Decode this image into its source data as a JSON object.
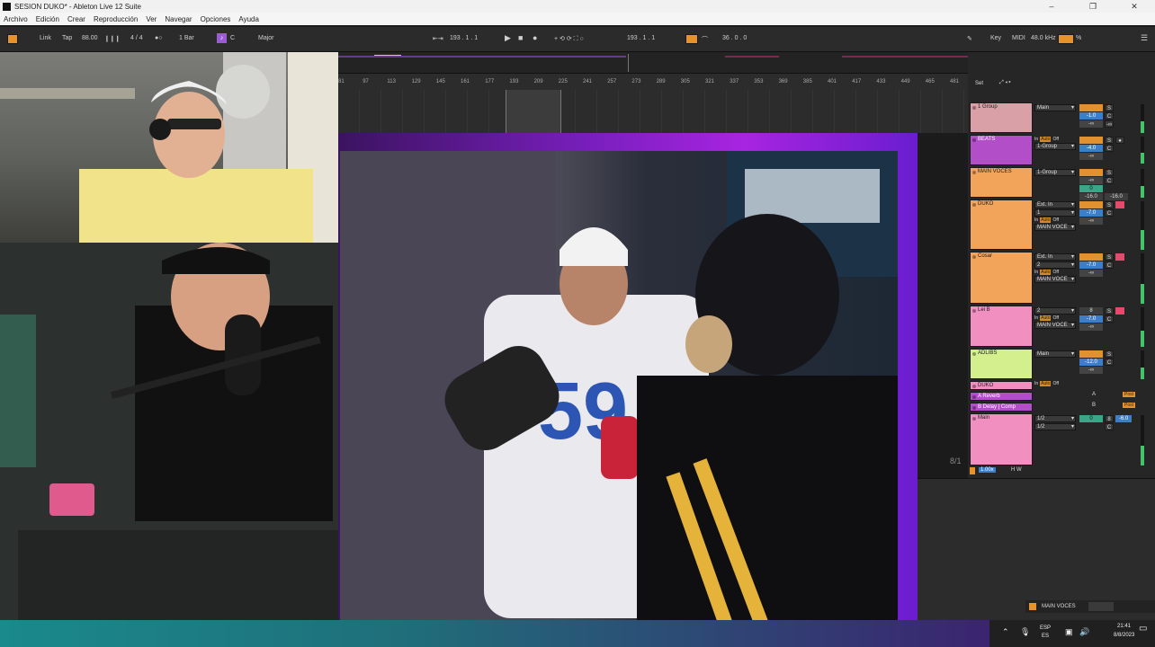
{
  "window": {
    "title": "SESION DUKO* - Ableton Live 12 Suite",
    "controls": [
      "–",
      "❐",
      "✕"
    ]
  },
  "menu": [
    "Archivo",
    "Edición",
    "Crear",
    "Reproducción",
    "Ver",
    "Navegar",
    "Opciones",
    "Ayuda"
  ],
  "control_bar": {
    "link": "Link",
    "tap": "Tap",
    "tempo": "88.00",
    "meter": "4 / 4",
    "quantize": "1 Bar",
    "key_root": "C",
    "scale": "Major",
    "position": "193 . 1 . 1",
    "loop_start": "193 . 1 . 1",
    "loop_length": "36 . 0 . 0",
    "key_label": "Key",
    "midi_label": "MIDI",
    "sample_rate": "48.0 kHz",
    "cpu": "%"
  },
  "ruler_ticks": [
    "81",
    "97",
    "113",
    "129",
    "145",
    "161",
    "177",
    "193",
    "209",
    "225",
    "241",
    "257",
    "273",
    "289",
    "305",
    "321",
    "337",
    "353",
    "369",
    "385",
    "401",
    "417",
    "433",
    "449",
    "465",
    "481"
  ],
  "mixer": {
    "set_label": "Set",
    "tracks": [
      {
        "name": "1 Group",
        "color": "#d9a0a8",
        "output": "Main",
        "vol": "-1.0",
        "pan": "C",
        "send": "-∞"
      },
      {
        "name": "BEATS",
        "color": "#b24fc8",
        "input": "In",
        "auto": "Auto",
        "off": "Off",
        "output": "1-Group",
        "vol": "-4.0",
        "pan": "C",
        "send": "-∞"
      },
      {
        "name": "MAIN VOCES",
        "color": "#f3a45b",
        "output": "1-Group",
        "vol": "0",
        "pan": "C",
        "send": "-∞",
        "peak_l": "-16.0",
        "peak_r": "-16.0"
      },
      {
        "name": "DUKO",
        "color": "#f3a45b",
        "input_type": "Ext. In",
        "channel": "1",
        "auto": "Auto",
        "off": "Off",
        "output": "MAIN VOCE",
        "vol": "-7.0",
        "pan": "C",
        "send": "-∞"
      },
      {
        "name": "Cosar",
        "color": "#f3a45b",
        "input_type": "Ext. In",
        "channel": "2",
        "auto": "Auto",
        "off": "Off",
        "output": "MAIN VOCE",
        "vol": "-7.0",
        "pan": "C",
        "send": "-∞"
      },
      {
        "name": "Lei B",
        "color": "#f08fc0",
        "channel": "2",
        "auto": "Auto",
        "off": "Off",
        "output": "MAIN VOCE",
        "vol": "-7.0",
        "pan": "C",
        "send": "-∞"
      },
      {
        "name": "ADLIBS",
        "color": "#d4ef8e",
        "output": "Main",
        "vol": "-12.0",
        "pan": "C",
        "send": "-∞"
      },
      {
        "name": "DUKO",
        "color": "#f08fc0",
        "input": "In",
        "auto": "Auto",
        "off": "Off"
      }
    ],
    "returns": [
      {
        "name": "A Reverb",
        "color": "#b24fc8",
        "letter": "A",
        "action": "Post"
      },
      {
        "name": "B Delay | Comp",
        "color": "#b24fc8",
        "letter": "B",
        "action": "Post"
      }
    ],
    "master": {
      "name": "Main",
      "color": "#f08fc0",
      "out1": "1/2",
      "out2": "1/2",
      "vol": "0",
      "vol2": "-6.0",
      "pan": "C"
    },
    "scene_counter": "8/1",
    "zoom": "1.00x",
    "hw": "H W"
  },
  "status": {
    "selected_track": "MAIN VOCES"
  },
  "taskbar": {
    "lang": "ESP",
    "region": "ES",
    "time": "21:41",
    "date": "8/8/2023"
  },
  "accent_colors": {
    "orange": "#e8932a",
    "purple": "#9c5bd4",
    "teal": "#3aa587"
  }
}
